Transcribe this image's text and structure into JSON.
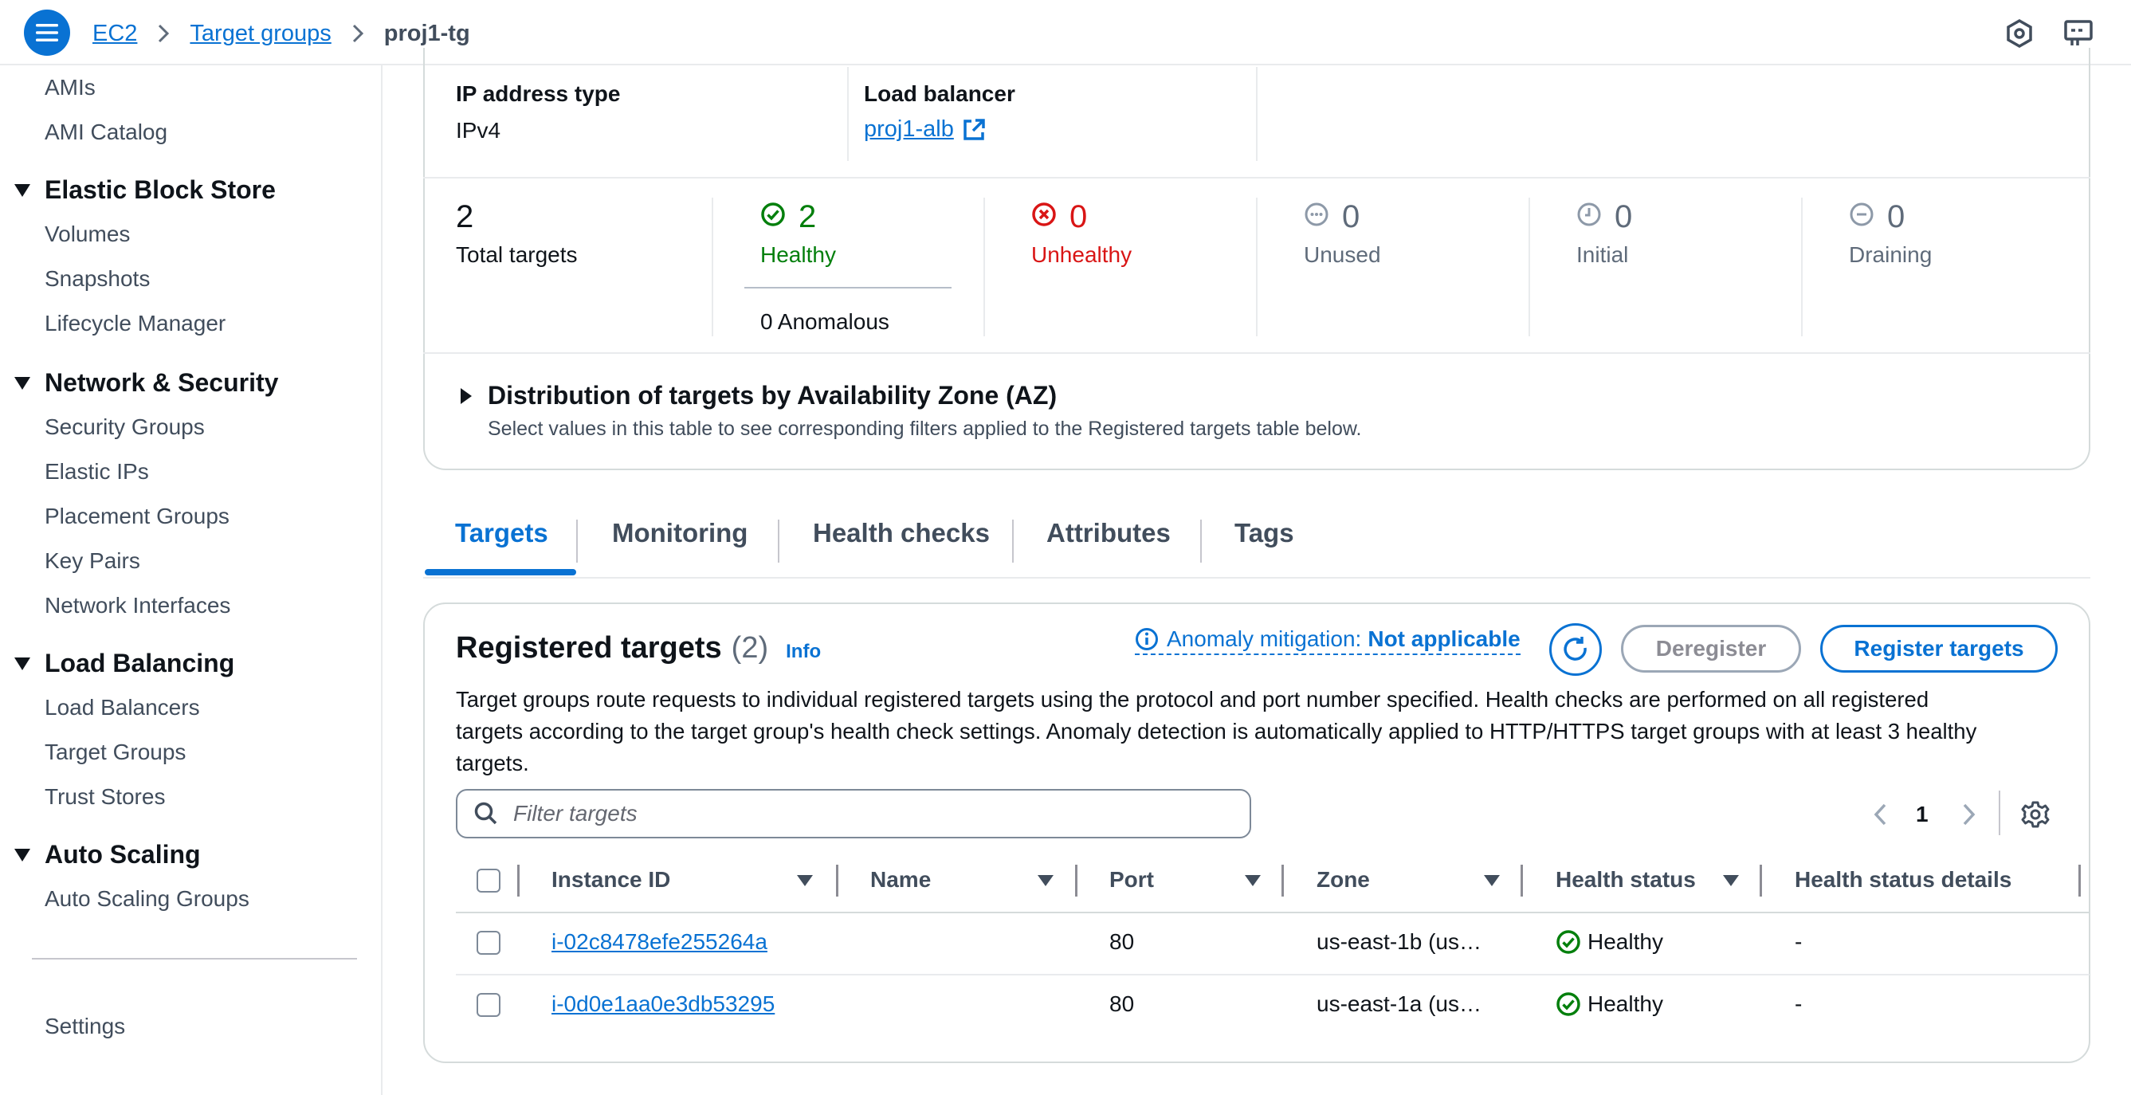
{
  "breadcrumb": {
    "items": [
      "EC2",
      "Target groups"
    ],
    "current": "proj1-tg"
  },
  "sidebar": {
    "sections": [
      {
        "title": null,
        "items": [
          "AMIs",
          "AMI Catalog"
        ]
      },
      {
        "title": "Elastic Block Store",
        "items": [
          "Volumes",
          "Snapshots",
          "Lifecycle Manager"
        ]
      },
      {
        "title": "Network & Security",
        "items": [
          "Security Groups",
          "Elastic IPs",
          "Placement Groups",
          "Key Pairs",
          "Network Interfaces"
        ]
      },
      {
        "title": "Load Balancing",
        "items": [
          "Load Balancers",
          "Target Groups",
          "Trust Stores"
        ]
      },
      {
        "title": "Auto Scaling",
        "items": [
          "Auto Scaling Groups"
        ]
      }
    ],
    "footer_item": "Settings"
  },
  "details": {
    "ip_type_label": "IP address type",
    "ip_type_value": "IPv4",
    "lb_label": "Load balancer",
    "lb_value": "proj1-alb"
  },
  "stats": {
    "total": {
      "value": "2",
      "label": "Total targets"
    },
    "healthy": {
      "value": "2",
      "label": "Healthy"
    },
    "anomalous": "0 Anomalous",
    "unhealthy": {
      "value": "0",
      "label": "Unhealthy"
    },
    "unused": {
      "value": "0",
      "label": "Unused"
    },
    "initial": {
      "value": "0",
      "label": "Initial"
    },
    "draining": {
      "value": "0",
      "label": "Draining"
    }
  },
  "distribution": {
    "title": "Distribution of targets by Availability Zone (AZ)",
    "description": "Select values in this table to see corresponding filters applied to the Registered targets table below."
  },
  "tabs": [
    "Targets",
    "Monitoring",
    "Health checks",
    "Attributes",
    "Tags"
  ],
  "registered": {
    "title": "Registered targets",
    "count": "(2)",
    "info": "Info",
    "anomaly_label": "Anomaly mitigation:",
    "anomaly_value": "Not applicable",
    "deregister": "Deregister",
    "register": "Register targets",
    "description_lines": [
      "Target groups route requests to individual registered targets using the protocol and port number specified. Health checks are performed on all registered",
      "targets according to the target group's health check settings. Anomaly detection is automatically applied to HTTP/HTTPS target groups with at least 3 healthy",
      "targets."
    ],
    "filter_placeholder": "Filter targets",
    "page": "1",
    "columns": [
      "Instance ID",
      "Name",
      "Port",
      "Zone",
      "Health status",
      "Health status details"
    ],
    "rows": [
      {
        "instance_id": "i-02c8478efe255264a",
        "name": "",
        "port": "80",
        "zone": "us-east-1b (us…",
        "health": "Healthy",
        "details": "-"
      },
      {
        "instance_id": "i-0d0e1aa0e3db53295",
        "name": "",
        "port": "80",
        "zone": "us-east-1a (us…",
        "health": "Healthy",
        "details": "-"
      }
    ]
  },
  "colors": {
    "accent": "#0972d3",
    "healthy": "#037f0c",
    "unhealthy": "#d91515",
    "muted": "#5f6b7a"
  }
}
